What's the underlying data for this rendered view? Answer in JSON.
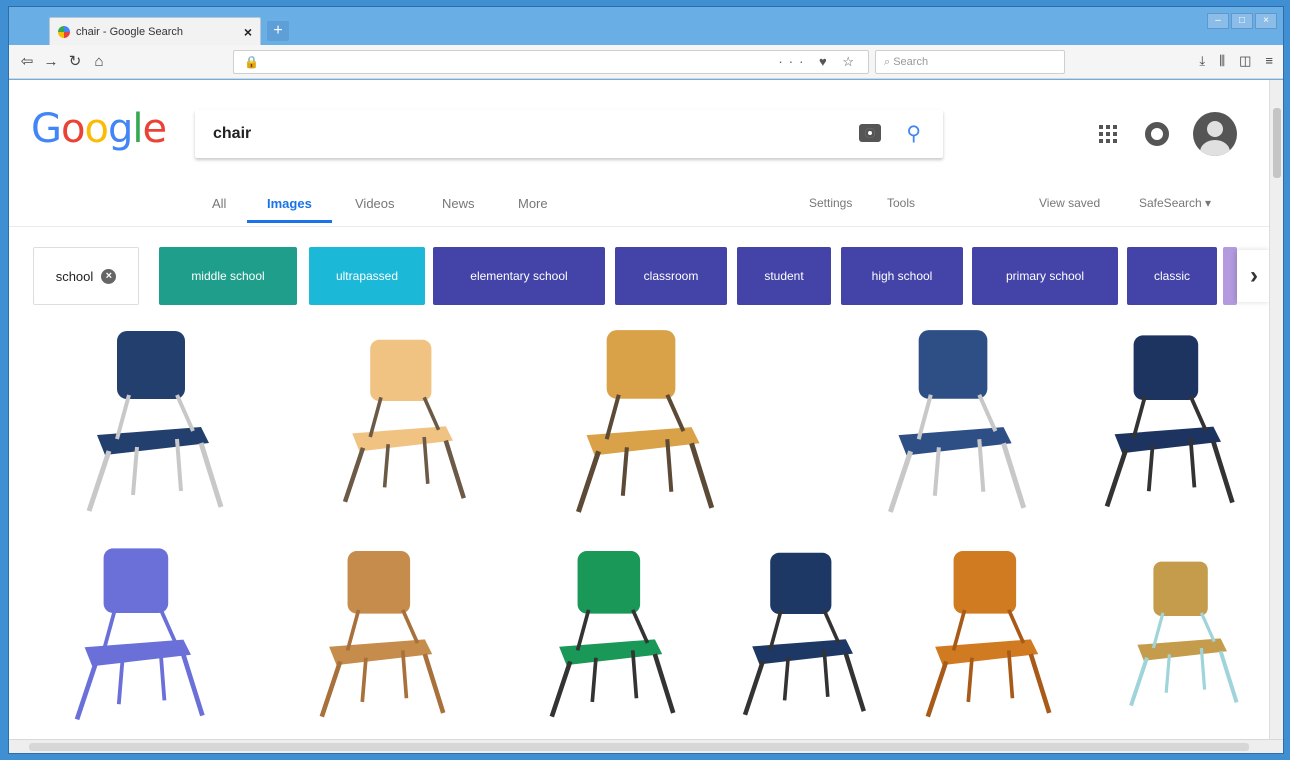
{
  "browser": {
    "tab_title": "chair - Google Search",
    "tab_close": "×",
    "new_tab": "+",
    "search_placeholder": "Search",
    "url_actions": "··· ♥ ☆",
    "window_controls": [
      "–",
      "□",
      "×"
    ]
  },
  "google": {
    "logo_letters": [
      "G",
      "o",
      "o",
      "g",
      "l",
      "e"
    ],
    "query": "chair",
    "nav_tabs": [
      "All",
      "Images",
      "Videos",
      "News",
      "More"
    ],
    "active_tab": "Images",
    "settings": "Settings",
    "tools": "Tools",
    "view_saved": "View saved",
    "safesearch": "SafeSearch ▾"
  },
  "chips": [
    {
      "label": "school"
    },
    {
      "label": "middle school"
    },
    {
      "label": "ultrapassed"
    },
    {
      "label": "elementary school"
    },
    {
      "label": "classroom"
    },
    {
      "label": "student"
    },
    {
      "label": "high school"
    },
    {
      "label": "primary school"
    },
    {
      "label": "classic"
    }
  ],
  "chip_next": "›",
  "results": [
    {
      "name": "navy-plastic-school-chair",
      "seat": "#233f6e",
      "frame": "#c8c8c8"
    },
    {
      "name": "birch-plywood-school-chair",
      "seat": "#f0c382",
      "frame": "#6b5a46"
    },
    {
      "name": "tablet-arm-desk-chair",
      "seat": "#d9a248",
      "frame": "#5c4a36"
    },
    {
      "name": "navy-plastic-school-chair-angled",
      "seat": "#2e4f86",
      "frame": "#c8c8c8"
    },
    {
      "name": "navy-cutout-chair",
      "seat": "#1d3461",
      "frame": "#333333"
    },
    {
      "name": "blue-stackable-plastic-chair",
      "seat": "#6a70d8",
      "frame": "#6a70d8"
    },
    {
      "name": "wooden-school-chair",
      "seat": "#c58c4c",
      "frame": "#a8703a"
    },
    {
      "name": "green-polypropylene-chair",
      "seat": "#1a9858",
      "frame": "#333333"
    },
    {
      "name": "navy-cutout-chair-front",
      "seat": "#1e3866",
      "frame": "#333333"
    },
    {
      "name": "wooden-tablet-arm-chair",
      "seat": "#d07a22",
      "frame": "#a85a18"
    },
    {
      "name": "wood-seat-light-frame-chair",
      "seat": "#c49c4c",
      "frame": "#9fd4da"
    }
  ]
}
